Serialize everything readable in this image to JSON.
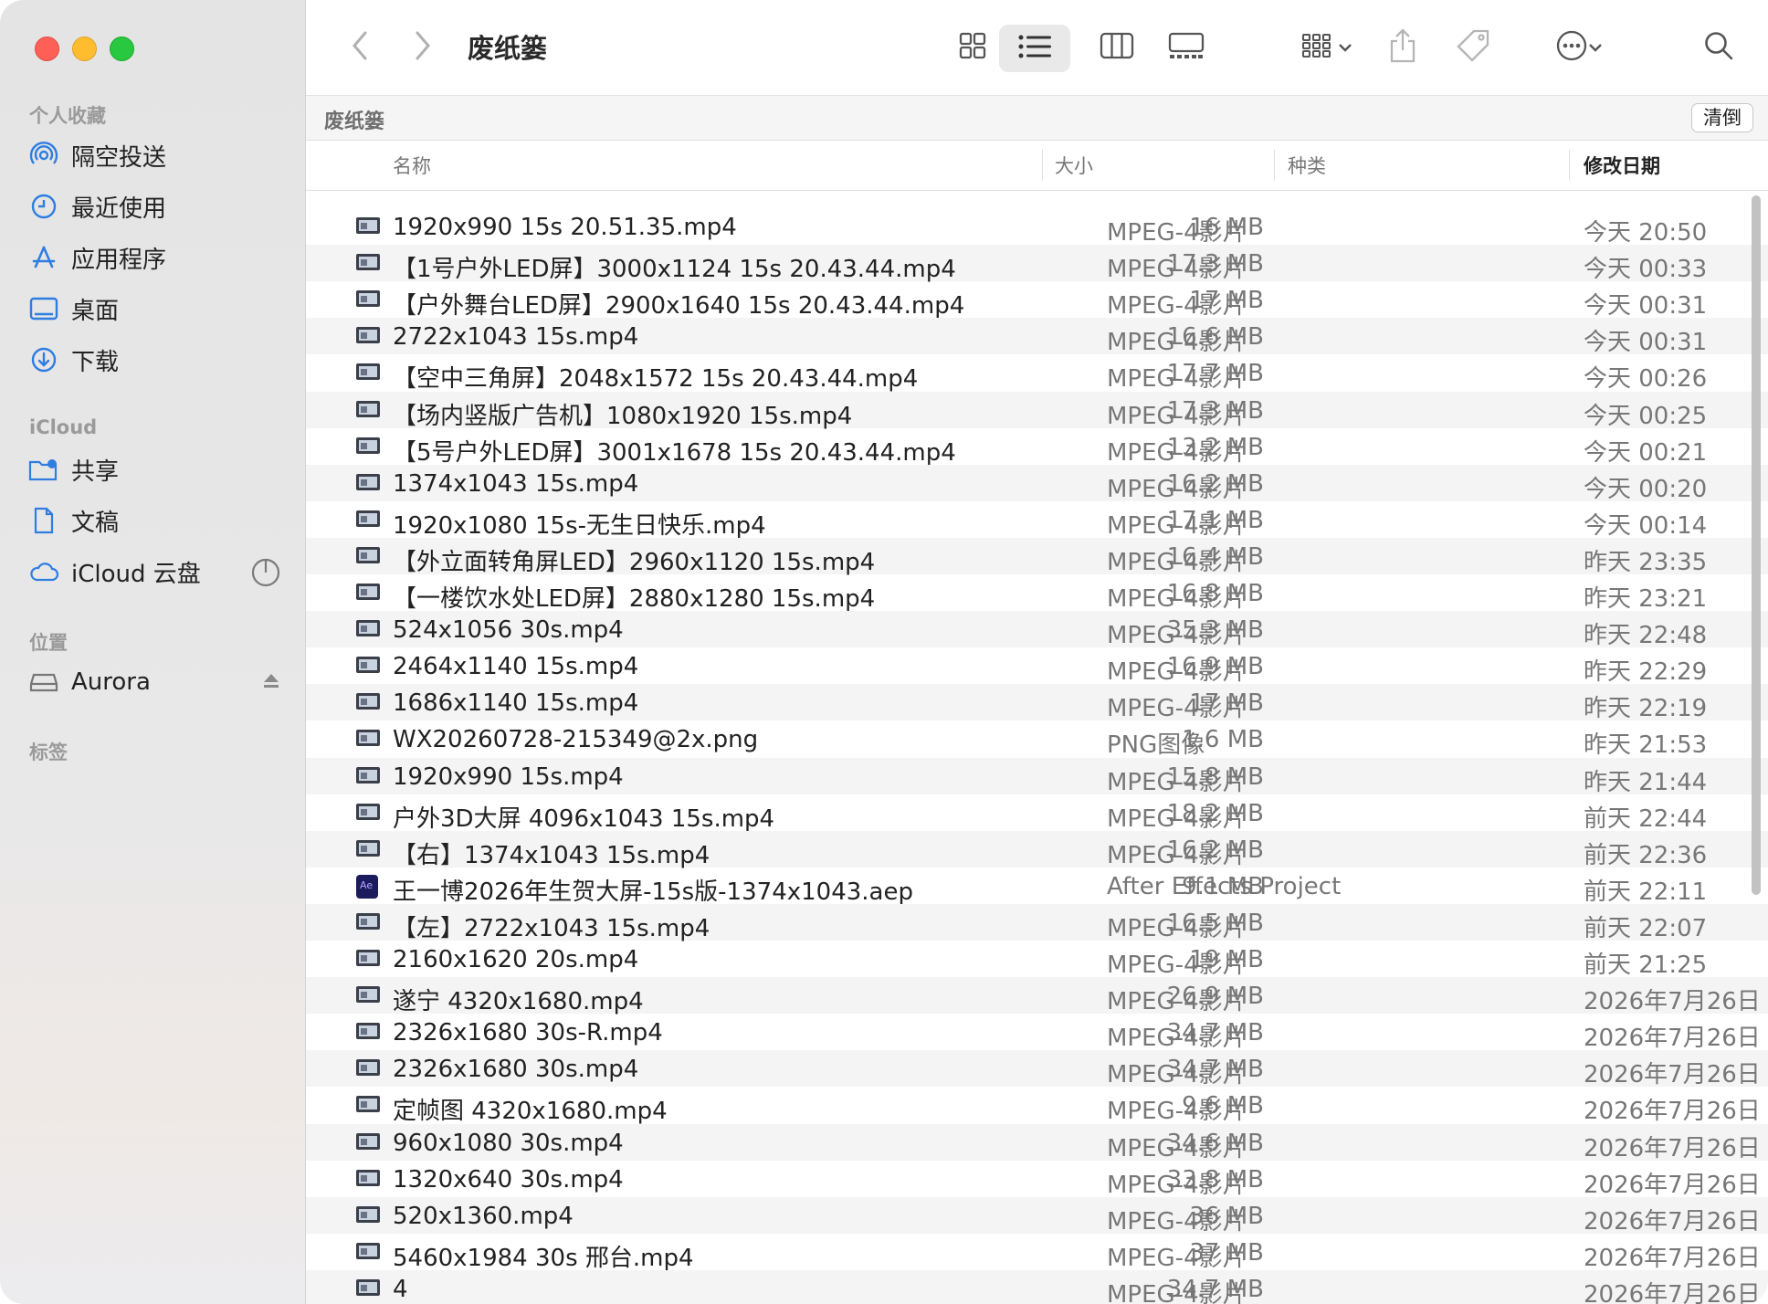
{
  "window": {
    "title": "废纸篓"
  },
  "sidebar": {
    "favorites_title": "个人收藏",
    "favorites": [
      {
        "label": "隔空投送",
        "icon": "airdrop-icon"
      },
      {
        "label": "最近使用",
        "icon": "clock-icon"
      },
      {
        "label": "应用程序",
        "icon": "applications-icon"
      },
      {
        "label": "桌面",
        "icon": "desktop-icon"
      },
      {
        "label": "下载",
        "icon": "download-icon"
      }
    ],
    "icloud_title": "iCloud",
    "icloud": [
      {
        "label": "共享",
        "icon": "shared-folder-icon"
      },
      {
        "label": "文稿",
        "icon": "document-icon"
      },
      {
        "label": "iCloud 云盘",
        "icon": "cloud-icon"
      }
    ],
    "locations_title": "位置",
    "locations": [
      {
        "label": "Aurora",
        "icon": "drive-icon"
      }
    ],
    "tags_title": "标签"
  },
  "pathbar": {
    "title": "废纸篓",
    "empty_button": "清倒"
  },
  "columns": {
    "name": "名称",
    "size": "大小",
    "kind": "种类",
    "date": "修改日期"
  },
  "files": [
    {
      "name": "1920x990 15s 20.51.35.mp4",
      "size": "16 MB",
      "kind": "MPEG-4影片",
      "date": "今天 20:50"
    },
    {
      "name": "【1号户外LED屏】3000x1124 15s 20.43.44.mp4",
      "size": "17.3 MB",
      "kind": "MPEG-4影片",
      "date": "今天 00:33"
    },
    {
      "name": "【户外舞台LED屏】2900x1640 15s 20.43.44.mp4",
      "size": "17 MB",
      "kind": "MPEG-4影片",
      "date": "今天 00:31"
    },
    {
      "name": "2722x1043 15s.mp4",
      "size": "16.6 MB",
      "kind": "MPEG-4影片",
      "date": "今天 00:31"
    },
    {
      "name": "【空中三角屏】2048x1572 15s 20.43.44.mp4",
      "size": "17.7 MB",
      "kind": "MPEG-4影片",
      "date": "今天 00:26"
    },
    {
      "name": "【场内竖版广告机】1080x1920 15s.mp4",
      "size": "17.3 MB",
      "kind": "MPEG-4影片",
      "date": "今天 00:25"
    },
    {
      "name": "【5号户外LED屏】3001x1678 15s 20.43.44.mp4",
      "size": "13.2 MB",
      "kind": "MPEG-4影片",
      "date": "今天 00:21"
    },
    {
      "name": "1374x1043 15s.mp4",
      "size": "16.2 MB",
      "kind": "MPEG-4影片",
      "date": "今天 00:20"
    },
    {
      "name": "1920x1080 15s-无生日快乐.mp4",
      "size": "17.1 MB",
      "kind": "MPEG-4影片",
      "date": "今天 00:14"
    },
    {
      "name": "【外立面转角屏LED】2960x1120 15s.mp4",
      "size": "16.4 MB",
      "kind": "MPEG-4影片",
      "date": "昨天 23:35"
    },
    {
      "name": "【一楼饮水处LED屏】2880x1280 15s.mp4",
      "size": "16.8 MB",
      "kind": "MPEG-4影片",
      "date": "昨天 23:21"
    },
    {
      "name": "524x1056 30s.mp4",
      "size": "35.3 MB",
      "kind": "MPEG-4影片",
      "date": "昨天 22:48"
    },
    {
      "name": "2464x1140 15s.mp4",
      "size": "16.9 MB",
      "kind": "MPEG-4影片",
      "date": "昨天 22:29"
    },
    {
      "name": "1686x1140 15s.mp4",
      "size": "17 MB",
      "kind": "MPEG-4影片",
      "date": "昨天 22:19"
    },
    {
      "name": "WX20260728-215349@2x.png",
      "size": "1.6 MB",
      "kind": "PNG图像",
      "date": "昨天 21:53"
    },
    {
      "name": "1920x990 15s.mp4",
      "size": "15.8 MB",
      "kind": "MPEG-4影片",
      "date": "昨天 21:44"
    },
    {
      "name": "户外3D大屏 4096x1043 15s.mp4",
      "size": "18.2 MB",
      "kind": "MPEG-4影片",
      "date": "前天 22:44"
    },
    {
      "name": "【右】1374x1043 15s.mp4",
      "size": "16.2 MB",
      "kind": "MPEG-4影片",
      "date": "前天 22:36"
    },
    {
      "name": "王一博2026年生贺大屏-15s版-1374x1043.aep",
      "size": "9.1 MB",
      "kind": "After Effects Project",
      "date": "前天 22:11"
    },
    {
      "name": "【左】2722x1043 15s.mp4",
      "size": "16.5 MB",
      "kind": "MPEG-4影片",
      "date": "前天 22:07"
    },
    {
      "name": "2160x1620 20s.mp4",
      "size": "19 MB",
      "kind": "MPEG-4影片",
      "date": "前天 21:25"
    },
    {
      "name": "遂宁 4320x1680.mp4",
      "size": "26.9 MB",
      "kind": "MPEG-4影片",
      "date": "2026年7月26日"
    },
    {
      "name": "2326x1680 30s-R.mp4",
      "size": "34.7 MB",
      "kind": "MPEG-4影片",
      "date": "2026年7月26日"
    },
    {
      "name": "2326x1680 30s.mp4",
      "size": "34.7 MB",
      "kind": "MPEG-4影片",
      "date": "2026年7月26日"
    },
    {
      "name": "定帧图 4320x1680.mp4",
      "size": "9.6 MB",
      "kind": "MPEG-4影片",
      "date": "2026年7月26日"
    },
    {
      "name": "960x1080 30s.mp4",
      "size": "34.6 MB",
      "kind": "MPEG-4影片",
      "date": "2026年7月26日"
    },
    {
      "name": "1320x640 30s.mp4",
      "size": "33.8 MB",
      "kind": "MPEG-4影片",
      "date": "2026年7月26日"
    },
    {
      "name": "520x1360.mp4",
      "size": "36 MB",
      "kind": "MPEG-4影片",
      "date": "2026年7月26日"
    },
    {
      "name": "5460x1984 30s 邢台.mp4",
      "size": "37 MB",
      "kind": "MPEG-4影片",
      "date": "2026年7月26日"
    },
    {
      "name": "4",
      "size": "34.7 MB",
      "kind": "MPEG-4影片",
      "date": "2026年7月26日"
    }
  ]
}
